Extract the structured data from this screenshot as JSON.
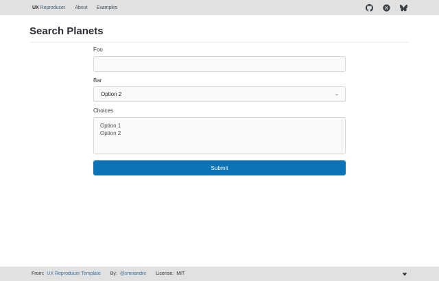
{
  "navbar": {
    "brand_bold": "UX",
    "brand_rest": " Reproducer",
    "links": [
      "About",
      "Examples"
    ],
    "icons": [
      "github-icon",
      "x-icon",
      "bluesky-icon"
    ]
  },
  "page": {
    "title": "Search Planets"
  },
  "form": {
    "foo_label": "Foo",
    "foo_value": "",
    "bar_label": "Bar",
    "bar_selected": "Option 2",
    "choices_label": "Choices",
    "choices_options": [
      "Option 1",
      "Option 2"
    ],
    "submit_label": "Submit"
  },
  "footer": {
    "from_label": "From:",
    "from_link": "UX Reproducer Template",
    "by_label": "By:",
    "by_link": "@smnandre",
    "license_label": "License:",
    "license_value": "MIT",
    "icon": "heart-icon"
  },
  "colors": {
    "navbar_bg": "#e1e1e1",
    "primary": "#0c73b4",
    "link": "#3b6f9a"
  }
}
